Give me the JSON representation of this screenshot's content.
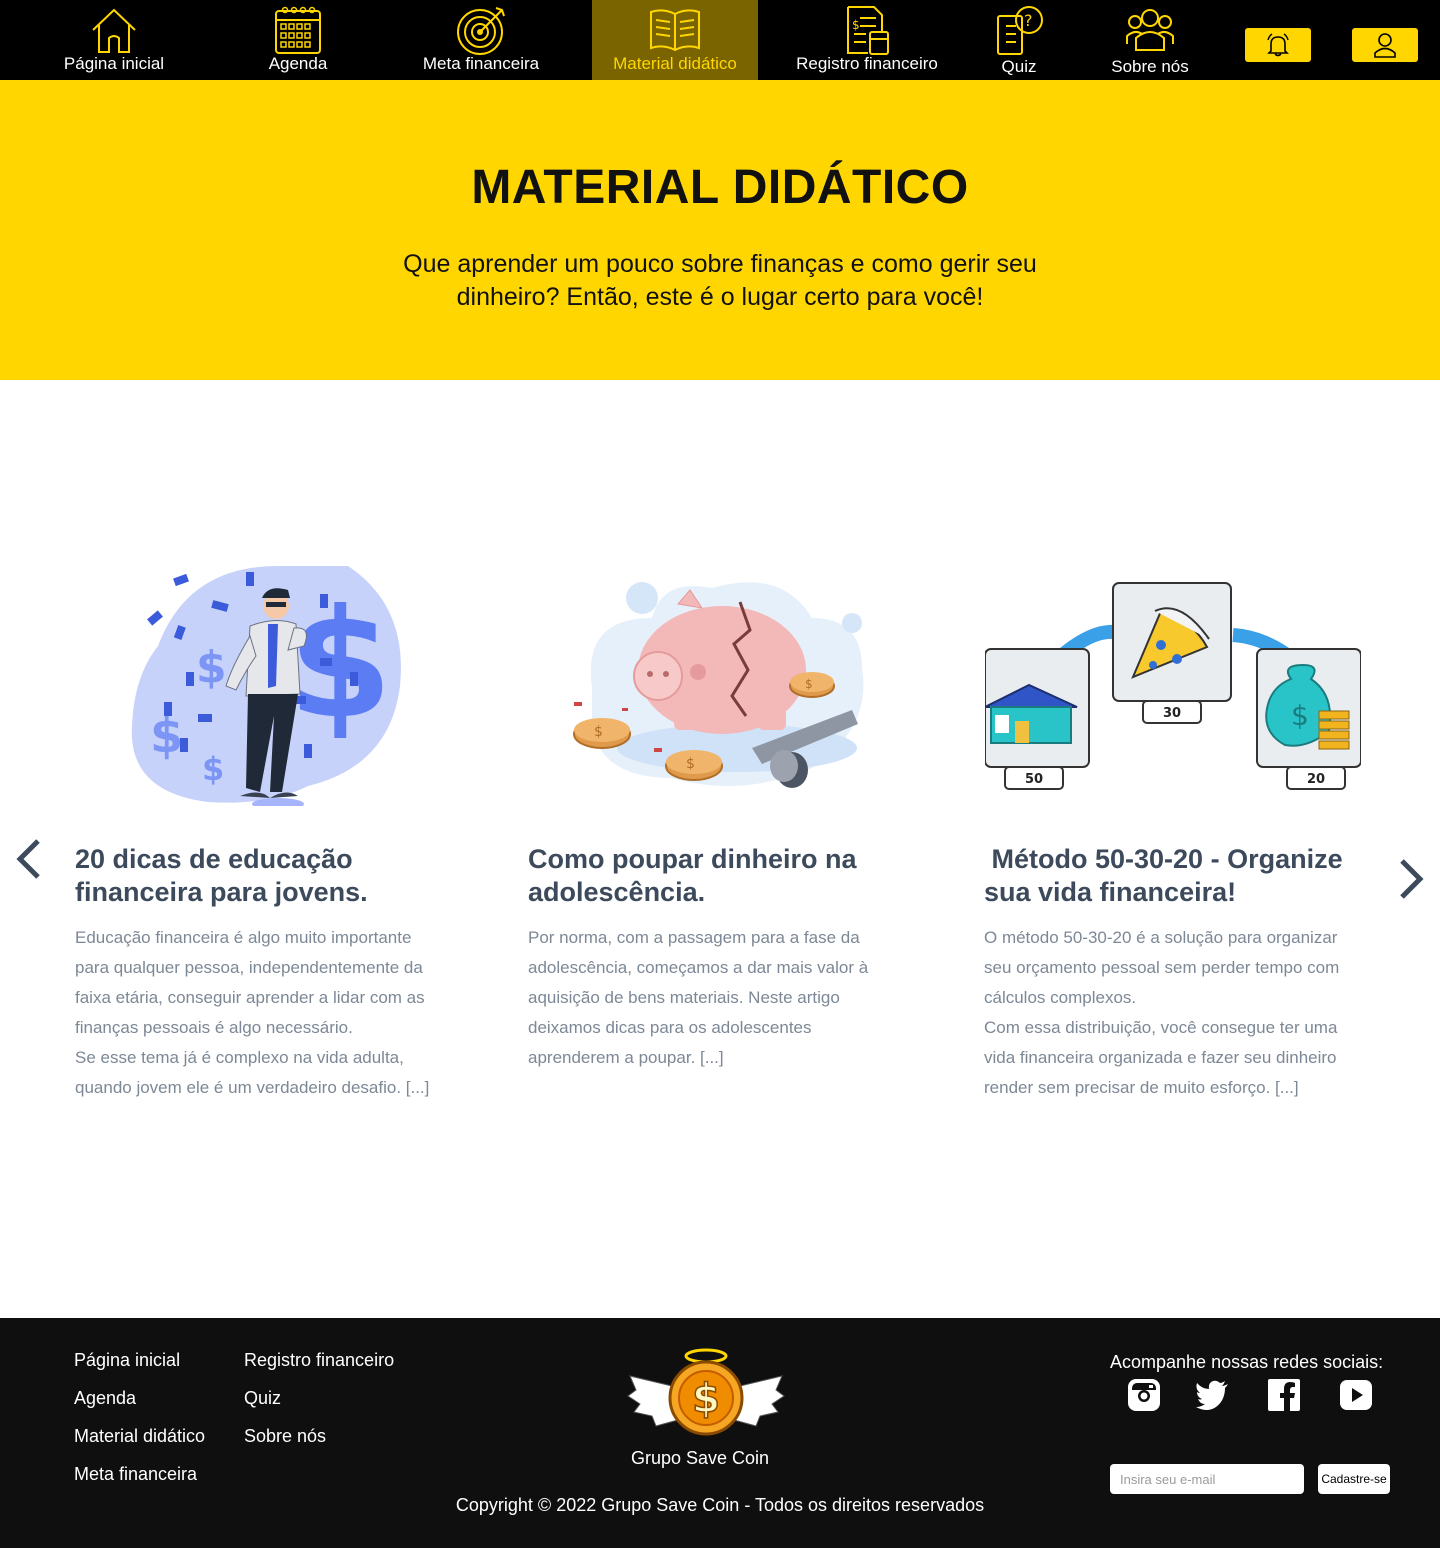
{
  "nav": {
    "items": [
      {
        "label": "Página inicial",
        "icon": "home-icon"
      },
      {
        "label": "Agenda",
        "icon": "calendar-icon"
      },
      {
        "label": "Meta financeira",
        "icon": "target-icon"
      },
      {
        "label": "Material didático",
        "icon": "book-icon",
        "active": true
      },
      {
        "label": "Registro financeiro",
        "icon": "ledger-icon"
      },
      {
        "label": "Quiz",
        "icon": "quiz-icon"
      },
      {
        "label": "Sobre nós",
        "icon": "group-icon"
      }
    ],
    "buttons": [
      "bell-icon",
      "user-icon"
    ],
    "accent": "#ffd600"
  },
  "hero": {
    "title": "MATERIAL DIDÁTICO",
    "subtitle": "Que aprender um pouco sobre finanças e como gerir seu dinheiro? Então, este é o lugar certo para você!"
  },
  "carousel": {
    "prev_icon": "chevron-left-icon",
    "next_icon": "chevron-right-icon",
    "cards": [
      {
        "title": "20 dicas de educação financeira para jovens.",
        "text_lines": [
          "Educação financeira é algo muito importante",
          "para qualquer pessoa, independentemente da",
          "faixa etária, conseguir aprender a lidar com as",
          "finanças pessoais é algo necessário.",
          "Se esse tema já é complexo na vida adulta,",
          "quando jovem ele é um verdadeiro desafio.  [...]"
        ]
      },
      {
        "title": "Como poupar dinheiro na adolescência.",
        "text_lines": [
          "Por norma, com a passagem para a fase da",
          "adolescência, começamos a dar mais valor à",
          "aquisição de bens materiais. Neste artigo",
          "deixamos dicas para os adolescentes",
          "aprenderem a poupar. [...]"
        ]
      },
      {
        "title": " Método 50-30-20 - Organize sua vida financeira!",
        "text_lines": [
          "O método 50-30-20 é a solução para organizar",
          "seu orçamento pessoal sem perder tempo com",
          "cálculos complexos.",
          "Com essa distribuição, você consegue ter uma",
          "vida financeira organizada e fazer seu dinheiro",
          "render sem precisar de muito esforço.  [...]"
        ],
        "image_labels": [
          "50",
          "30",
          "20"
        ]
      }
    ]
  },
  "footer": {
    "links_col1": [
      "Página inicial",
      "Agenda",
      "Material didático",
      "Meta financeira"
    ],
    "links_col2": [
      "Registro financeiro",
      "Quiz",
      "Sobre nós"
    ],
    "brand": "Grupo Save Coin",
    "copyright": "Copyright © 2022 Grupo Save Coin - Todos os direitos reservados",
    "social_title": "Acompanhe nossas redes sociais:",
    "social_icons": [
      "instagram-icon",
      "twitter-icon",
      "facebook-icon",
      "youtube-icon"
    ],
    "email_placeholder": "Insira seu e-mail",
    "signup_label": "Cadastre-se"
  }
}
